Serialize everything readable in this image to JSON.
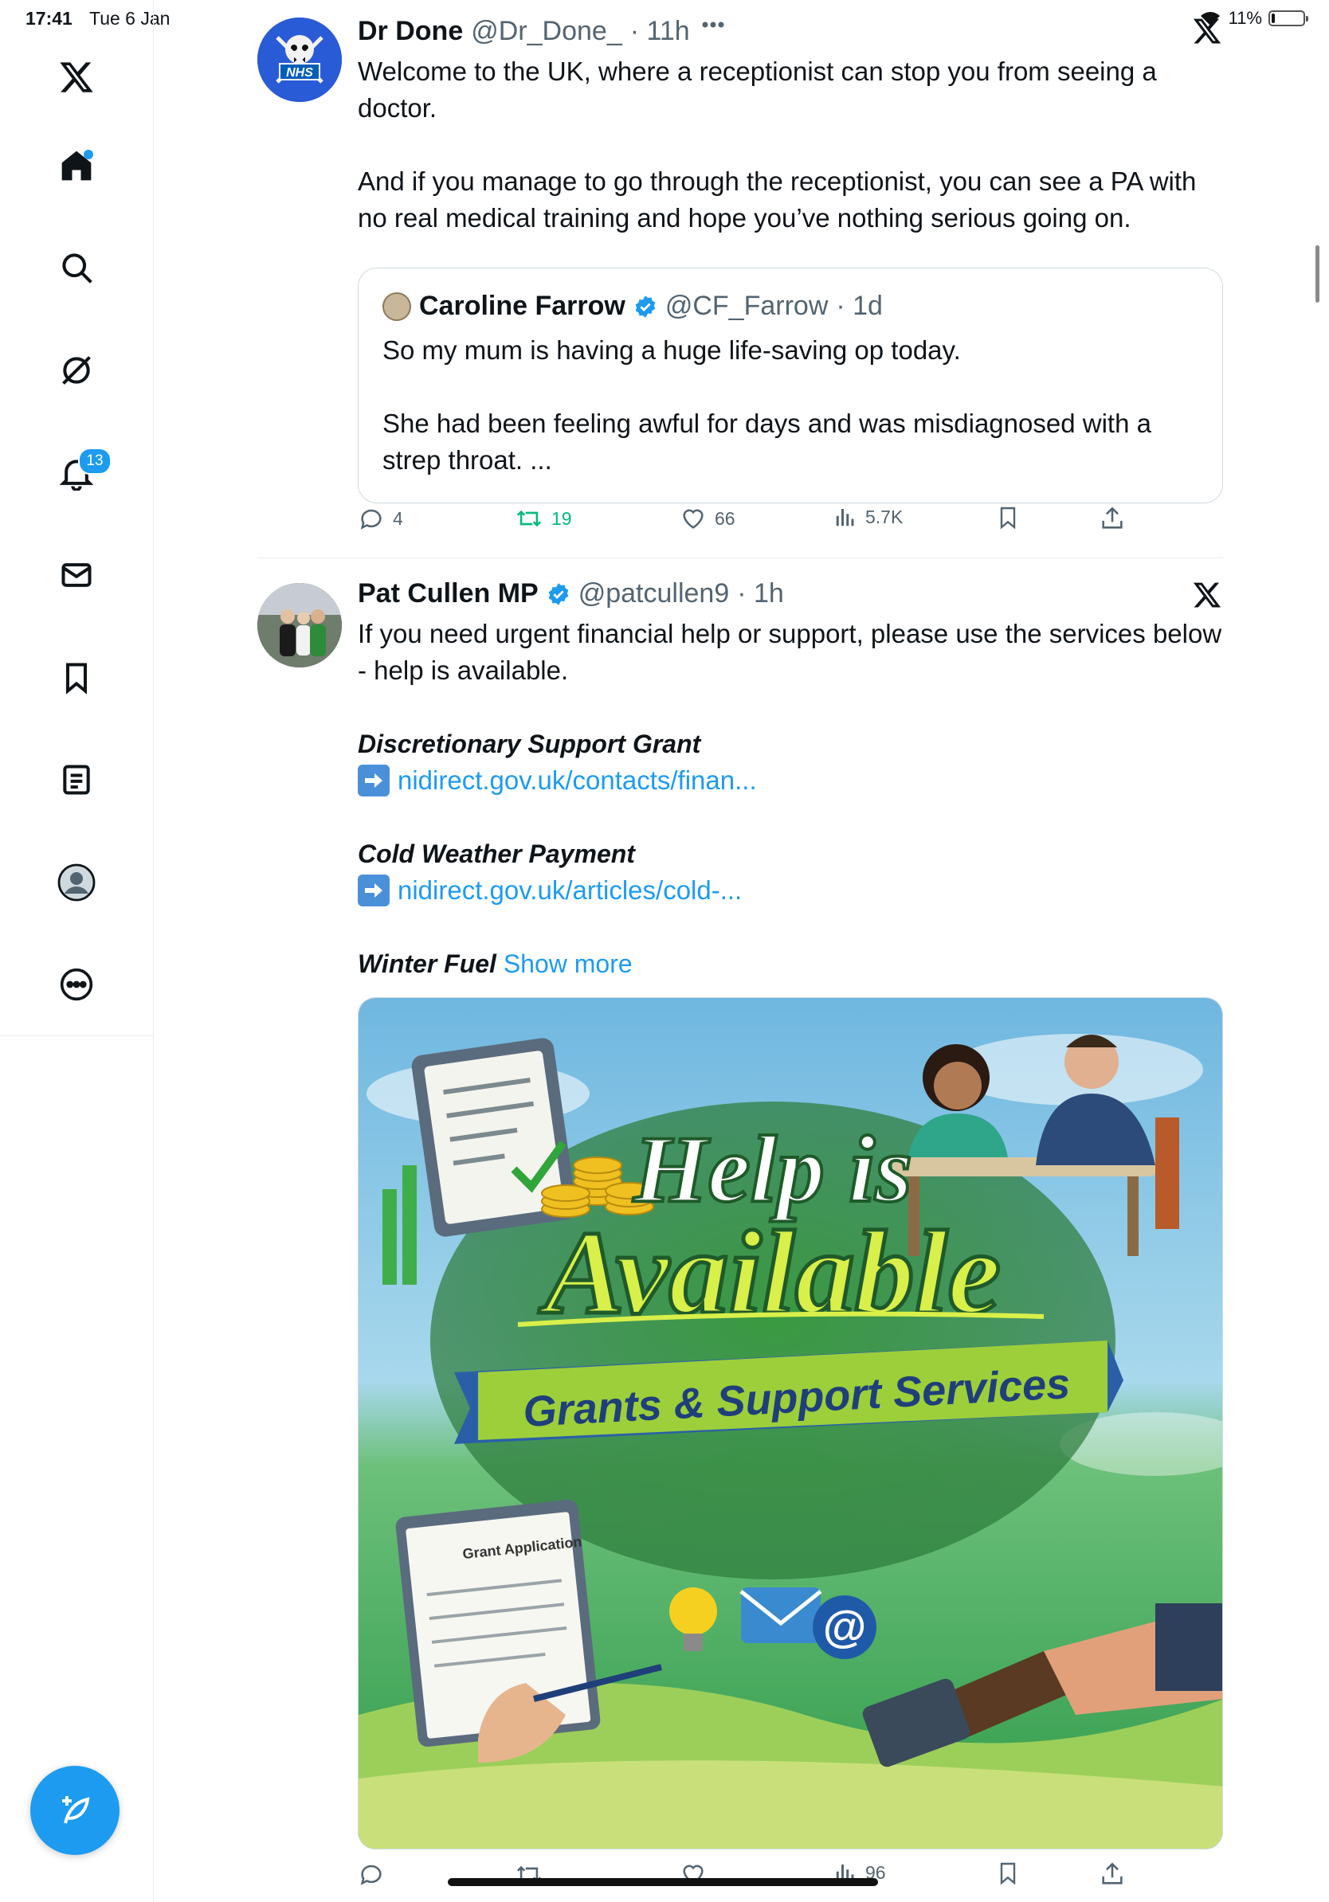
{
  "status_bar": {
    "time": "17:41",
    "date": "Tue 6 Jan",
    "battery": "11%",
    "battery_level": 0.11
  },
  "sidebar": {
    "items": [
      {
        "name": "x-logo-icon"
      },
      {
        "name": "home-icon"
      },
      {
        "name": "search-icon"
      },
      {
        "name": "grok-icon"
      },
      {
        "name": "notifications-icon",
        "badge": "13"
      },
      {
        "name": "messages-icon"
      },
      {
        "name": "bookmarks-icon"
      },
      {
        "name": "lists-icon"
      },
      {
        "name": "profile-icon"
      },
      {
        "name": "more-icon"
      }
    ],
    "compose": {
      "icon": "compose-icon"
    }
  },
  "feed": {
    "tweets": [
      {
        "name": "Dr Done",
        "handle": "@Dr_Done_",
        "time": "· 11h",
        "text": "Welcome to the UK, where a receptionist can stop you from seeing a doctor.\n\nAnd if you manage to go through the receptionist, you can see a PA with no real medical training and hope you’ve nothing serious going on.",
        "quote": {
          "name": "Caroline Farrow",
          "handle": "@CF_Farrow",
          "time": "· 1d",
          "text": "So my mum is having a huge life-saving op today.\n\nShe had been feeling awful for days and was misdiagnosed with a strep throat. ..."
        },
        "stats": {
          "replies": "4",
          "reposts": "19",
          "likes": "66",
          "views": "5.7K"
        },
        "avatar_text": "NHS"
      },
      {
        "name": "Pat Cullen MP",
        "handle": "@patcullen9",
        "time": "· 1h",
        "text": "If you need urgent financial help or support, please use the services below - help is available.",
        "sections": [
          {
            "title": "Discretionary Support Grant",
            "link": "nidirect.gov.uk/contacts/finan..."
          },
          {
            "title": "Cold Weather Payment",
            "link": "nidirect.gov.uk/articles/cold-..."
          }
        ],
        "winter_fuel": "Winter Fuel",
        "show_more": "Show more",
        "image": {
          "headline_1": "Help is",
          "headline_2": "Available",
          "banner": "Grants & Support Services",
          "form_label": "Grant Application"
        },
        "stats": {
          "views": "96"
        }
      }
    ]
  }
}
